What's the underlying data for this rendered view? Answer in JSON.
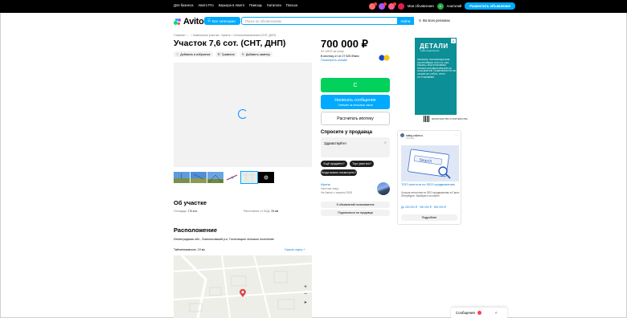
{
  "topbar": {
    "links": [
      "Для бизнеса",
      "Авито Pro",
      "Карьера в Авито",
      "Помощь",
      "Каталоги",
      "Польза"
    ],
    "catalogs_label": "Каталоги",
    "my_ads_label": "Мои объявления",
    "user_initial": "А",
    "user_name": "Анатолий",
    "post_label": "Разместить объявление"
  },
  "header": {
    "logo": "Avito",
    "categories_label": "Все категории",
    "search_placeholder": "Поиск по объявлениям",
    "find_label": "Найти",
    "region_label": "Во всех регионах"
  },
  "breadcrumbs": "Главная › … › Земельные участки › Купить › Сельхозназначения (СНТ, ДНП)",
  "listing": {
    "title": "Участок 7,6 сот. (СНТ, ДНП)",
    "actions": [
      "Добавить в избранное",
      "Сравнить",
      "Добавить заметку"
    ],
    "about_title": "Об участке",
    "area_label": "Площадь:",
    "area_value": "7.6 сот.",
    "kad_label": "Расстояние от КАД:",
    "kad_value": "19 км",
    "location_title": "Расположение",
    "address": "Ленинградская обл., Ломоносовский р-н, Гостилицкое сельское поселение",
    "distance": "Тайлинюковское, 19 км",
    "hide_map_label": "Скрыть карту"
  },
  "sidebar": {
    "price": "700 000 ₽",
    "price_per_area": "92 105 ₽ за сотку",
    "mortgage": "В ипотеку от от 27 525 ₽/мес",
    "mortgage_link": "Посмотреть онлайн",
    "show_phone_label": "С",
    "write_label": "Написать сообщение",
    "write_sub": "Отвечает за несколько часов",
    "calc_label": "Рассчитать ипотеку",
    "ask_title": "Спросите у продавца",
    "ask_placeholder": "Здравствуйте!",
    "ask_chips": [
      "Ещё продаёте?",
      "Торг уместен?",
      "Когда можно посмотреть?"
    ],
    "seller_name": "Ирина",
    "seller_type": "Частное лицо",
    "seller_since": "На Авито с апреля 2005",
    "all_ads_label": "5 объявлений пользователя",
    "subscribe_label": "Подписаться на продавца"
  },
  "ads": {
    "top": {
      "brand": "ДЕТАЛИ",
      "brand_sub": "кафе-кондитерская",
      "body": "РЕКЛАМА. РЕКЛАМОДАТЕЛЬ: ЗАСТРОЙЩИК ООО СЗ «ЖК-РЫНКА» ИНН 9704198029. ПРОЕКТНАЯ ДЕКЛАРАЦИЯ НА НАШ.ДОМ.РФ. ПОДРОБНОСТИ ОБ АКЦИИ НА САЙТЕ. ОГРН 5177746280808.",
      "footer": "МИНИСТЕРСТВО СТРОИТЕЛЬСТВА"
    },
    "card": {
      "source": "rating-online.ru",
      "source_sub": "Реклама",
      "headline": "ТОП агентств по SEO продвижению",
      "body": "Лучшие агентства по SEO продвижению в Санкт-Петербурге. Выберите на сайте!",
      "price": "До 200 000 ₽ · 300 000 ₽ · 500 000 ₽",
      "button": "Подробнее",
      "img_word": "Search"
    }
  },
  "messages_bar": {
    "label": "Сообщения"
  }
}
